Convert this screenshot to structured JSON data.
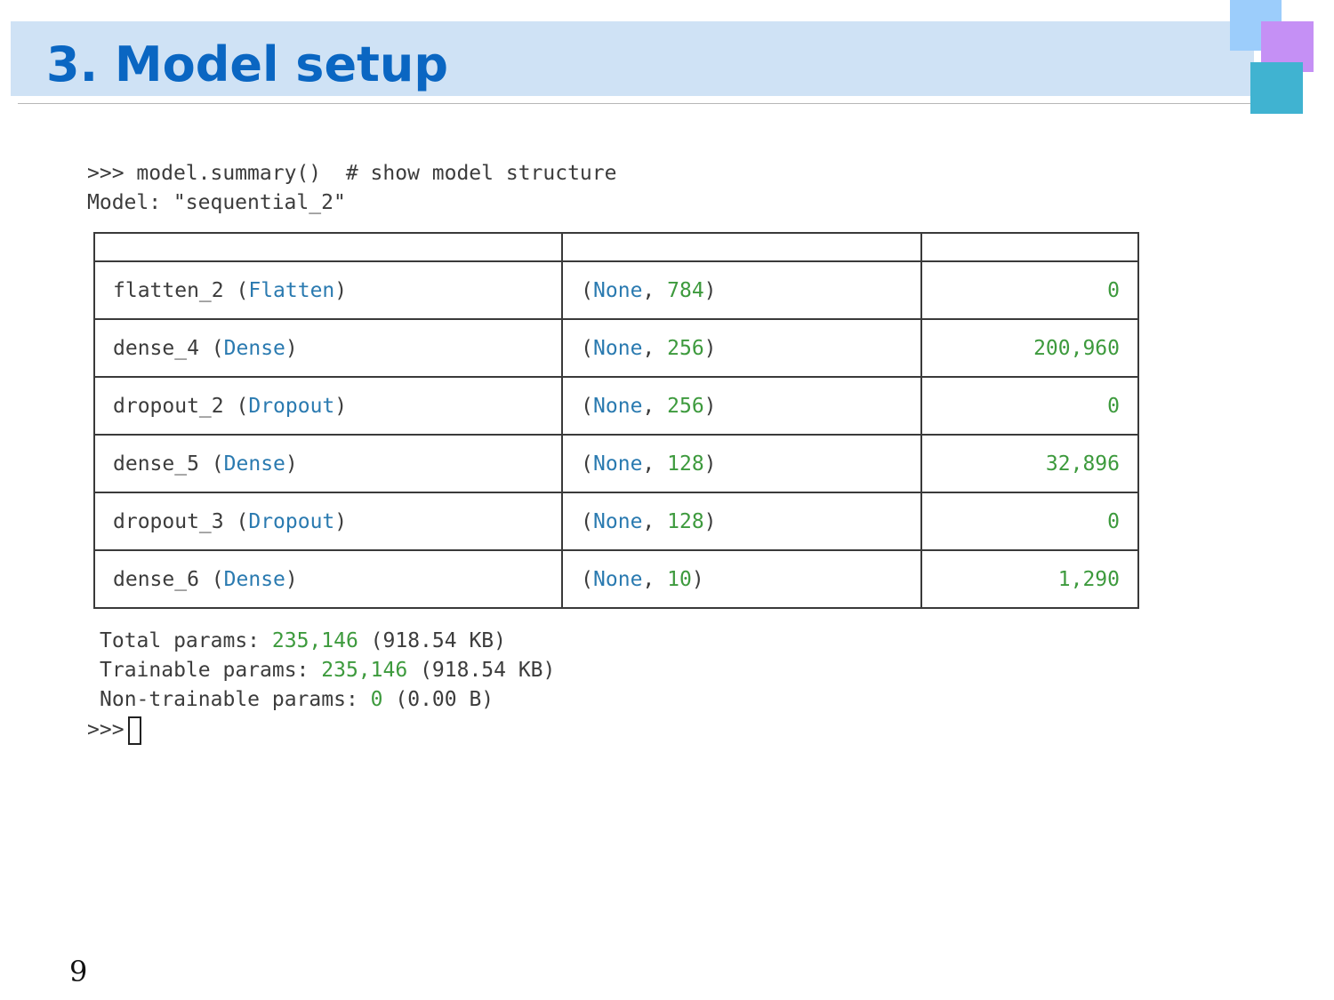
{
  "slide": {
    "title": "3. Model setup",
    "page_number": "9"
  },
  "console": {
    "prompt": ">>>",
    "command": "model.summary()",
    "comment": "# show model structure",
    "model_label": "Model: \"sequential_2\""
  },
  "table": {
    "header": [
      "",
      "",
      ""
    ],
    "rows": [
      {
        "name": "flatten_2",
        "type": "Flatten",
        "shape_none": "None",
        "shape_dim": "784",
        "params": "0"
      },
      {
        "name": "dense_4",
        "type": "Dense",
        "shape_none": "None",
        "shape_dim": "256",
        "params": "200,960"
      },
      {
        "name": "dropout_2",
        "type": "Dropout",
        "shape_none": "None",
        "shape_dim": "256",
        "params": "0"
      },
      {
        "name": "dense_5",
        "type": "Dense",
        "shape_none": "None",
        "shape_dim": "128",
        "params": "32,896"
      },
      {
        "name": "dropout_3",
        "type": "Dropout",
        "shape_none": "None",
        "shape_dim": "128",
        "params": "0"
      },
      {
        "name": "dense_6",
        "type": "Dense",
        "shape_none": "None",
        "shape_dim": "10",
        "params": "1,290"
      }
    ]
  },
  "summary": {
    "total_label": "Total params:",
    "total_value": "235,146",
    "total_size": "(918.54 KB)",
    "trainable_label": "Trainable params:",
    "trainable_value": "235,146",
    "trainable_size": "(918.54 KB)",
    "nontrainable_label": "Non-trainable params:",
    "nontrainable_value": "0",
    "nontrainable_size": "(0.00 B)"
  },
  "colors": {
    "title": "#0a66c2",
    "title_band": "#cfe2f5",
    "keyword_blue": "#2a7ab0",
    "number_green": "#3d9a3d",
    "square_light_blue": "#9ccdfb",
    "square_purple": "#c590f5",
    "square_teal": "#40b3d1"
  }
}
